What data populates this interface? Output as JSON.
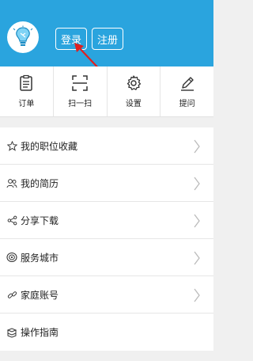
{
  "header": {
    "login_label": "登录",
    "register_label": "注册",
    "bg_color": "#2aa4de",
    "arrow_color": "#e02020"
  },
  "quickbar": {
    "items": [
      {
        "label": "订单",
        "icon": "order-icon"
      },
      {
        "label": "扫一扫",
        "icon": "scan-icon"
      },
      {
        "label": "设置",
        "icon": "gear-icon"
      },
      {
        "label": "提问",
        "icon": "pencil-icon"
      }
    ]
  },
  "menu": {
    "items": [
      {
        "label": "我的职位收藏",
        "icon": "star-icon",
        "chevron": true
      },
      {
        "label": "我的简历",
        "icon": "people-icon",
        "chevron": true
      },
      {
        "label": "分享下载",
        "icon": "share-icon",
        "chevron": true
      },
      {
        "label": "服务城市",
        "icon": "city-icon",
        "chevron": true
      },
      {
        "label": "家庭账号",
        "icon": "link-icon",
        "chevron": true
      },
      {
        "label": "操作指南",
        "icon": "guide-icon",
        "chevron": false
      }
    ]
  }
}
